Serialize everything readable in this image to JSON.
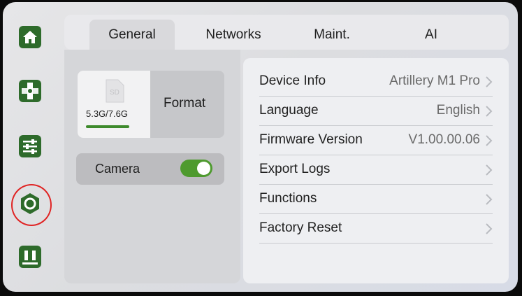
{
  "sidebar": {
    "items": [
      {
        "icon": "home-icon"
      },
      {
        "icon": "move-icon"
      },
      {
        "icon": "adjust-icon"
      },
      {
        "icon": "settings-icon",
        "selected": true
      },
      {
        "icon": "pause-icon"
      }
    ],
    "accent_color": "#2e6b2b",
    "highlight_color": "#e02424"
  },
  "tabs": [
    {
      "label": "General",
      "active": true
    },
    {
      "label": "Networks",
      "active": false
    },
    {
      "label": "Maint.",
      "active": false
    },
    {
      "label": "AI",
      "active": false
    }
  ],
  "storage": {
    "usage_text": "5.3G/7.6G",
    "usage_fraction": 0.7,
    "format_label": "Format",
    "icon": "sd-card-icon"
  },
  "camera": {
    "label": "Camera",
    "enabled": true,
    "toggle_color": "#4e9a2e"
  },
  "settings": [
    {
      "label": "Device Info",
      "value": "Artillery M1 Pro"
    },
    {
      "label": "Language",
      "value": "English"
    },
    {
      "label": "Firmware Version",
      "value": "V1.00.00.06"
    },
    {
      "label": "Export Logs",
      "value": ""
    },
    {
      "label": "Functions",
      "value": ""
    },
    {
      "label": "Factory Reset",
      "value": ""
    }
  ]
}
